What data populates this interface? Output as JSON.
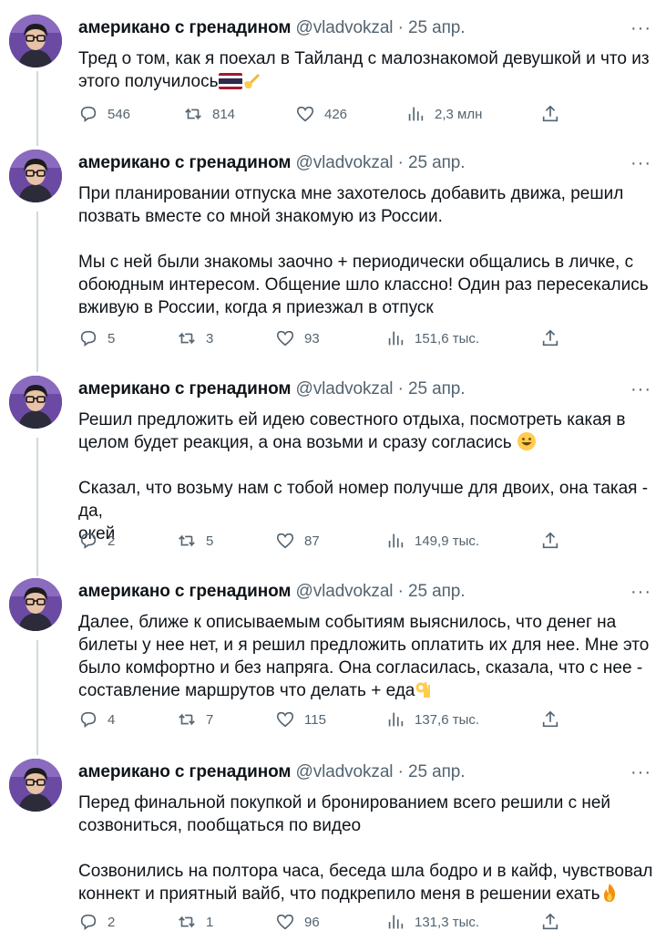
{
  "colors": {
    "text": "#0f1419",
    "secondary": "#536471",
    "thread_line": "#cfd9de"
  },
  "author": {
    "name": "американо с гренадином",
    "handle": "@vladvokzal",
    "separator": "·",
    "date": "25 апр."
  },
  "more_label": "···",
  "tweets": [
    {
      "text": "Тред о том, как я поехал в Тайланд с малознакомой девушкой и что из\nэтого получилось",
      "emoji": [
        "thailand-flag",
        "writing-hand"
      ],
      "replies": "546",
      "retweets": "814",
      "likes": "426",
      "views": "2,3 млн"
    },
    {
      "text": "При планировании отпуска мне захотелось добавить движа, решил\nпозвать вместе со мной знакомую из России.\n\nМы с ней были знакомы заочно + периодически общались в личке, с\nобоюдным интересом. Общение шло классно! Один раз пересекались\nвживую в России, когда я приезжал в отпуск",
      "emoji": [],
      "replies": "5",
      "retweets": "3",
      "likes": "93",
      "views": "151,6 тыс."
    },
    {
      "text": "Решил предложить ей идею совестного отдыха, посмотреть какая в\nцелом будет реакция, а она возьми и сразу согласись",
      "text2": "Сказал, что возьму нам с тобой номер получше для двоих, она такая - да,\nокей",
      "emoji": [
        "smiling-face"
      ],
      "replies": "2",
      "retweets": "5",
      "likes": "87",
      "views": "149,9 тыс."
    },
    {
      "text": "Далее, ближе к описываемым событиям выяснилось, что денег на\nбилеты у нее нет, и я решил предложить оплатить их для нее. Мне это\nбыло комфортно и без напряга. Она согласилась, сказала, что с нее -\nсоставление маршрутов что делать + еда",
      "emoji": [
        "ok-hand"
      ],
      "replies": "4",
      "retweets": "7",
      "likes": "115",
      "views": "137,6 тыс."
    },
    {
      "text": "Перед финальной покупкой и бронированием всего решили с ней\nсозвониться, пообщаться по видео\n\nСозвонились на полтора часа, беседа шла бодро и в кайф, чувствовал\nконнект и приятный вайб, что подкрепило меня в решении ехать",
      "emoji": [
        "fire"
      ],
      "replies": "2",
      "retweets": "1",
      "likes": "96",
      "views": "131,3 тыс."
    }
  ]
}
